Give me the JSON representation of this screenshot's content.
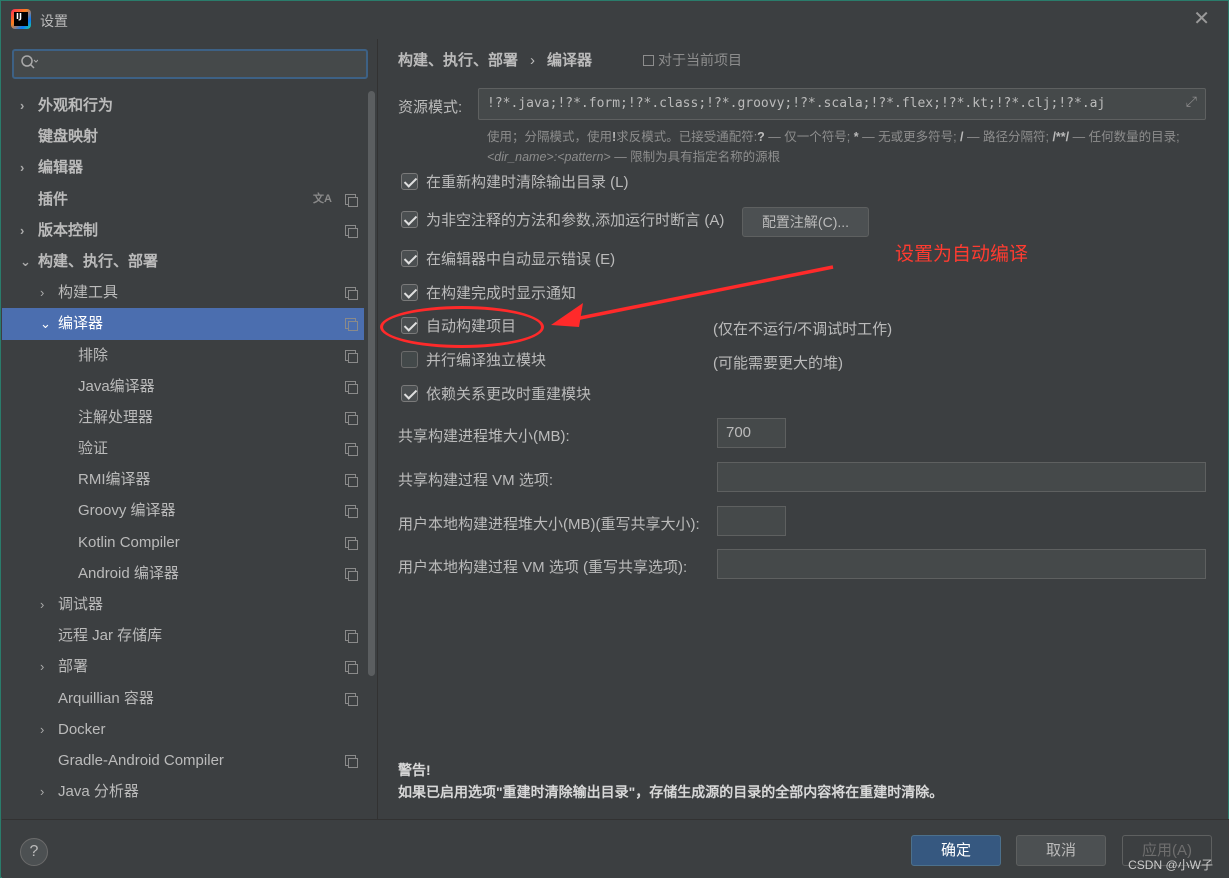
{
  "window": {
    "title": "设置",
    "close_glyph": "✕",
    "icon_text": "IJ"
  },
  "sidebar": {
    "search_placeholder": "",
    "items": [
      {
        "label": "外观和行为",
        "level": 0,
        "arrow": "›",
        "bold": true
      },
      {
        "label": "键盘映射",
        "level": 0,
        "arrow": "",
        "bold": true
      },
      {
        "label": "编辑器",
        "level": 0,
        "arrow": "›",
        "bold": true
      },
      {
        "label": "插件",
        "level": 0,
        "arrow": "",
        "bold": true,
        "icons": [
          "translate-icon",
          "project-icon"
        ]
      },
      {
        "label": "版本控制",
        "level": 0,
        "arrow": "›",
        "bold": true,
        "icons": [
          "project-icon"
        ]
      },
      {
        "label": "构建、执行、部署",
        "level": 0,
        "arrow": "⌄",
        "bold": true
      },
      {
        "label": "构建工具",
        "level": 1,
        "arrow": "›",
        "icons": [
          "project-icon"
        ]
      },
      {
        "label": "编译器",
        "level": 1,
        "arrow": "⌄",
        "selected": true,
        "icons": [
          "project-icon"
        ]
      },
      {
        "label": "排除",
        "level": 2,
        "arrow": "",
        "icons": [
          "project-icon"
        ]
      },
      {
        "label": "Java编译器",
        "level": 2,
        "arrow": "",
        "icons": [
          "project-icon"
        ]
      },
      {
        "label": "注解处理器",
        "level": 2,
        "arrow": "",
        "icons": [
          "project-icon"
        ]
      },
      {
        "label": "验证",
        "level": 2,
        "arrow": "",
        "icons": [
          "project-icon"
        ]
      },
      {
        "label": "RMI编译器",
        "level": 2,
        "arrow": "",
        "icons": [
          "project-icon"
        ]
      },
      {
        "label": "Groovy 编译器",
        "level": 2,
        "arrow": "",
        "icons": [
          "project-icon"
        ]
      },
      {
        "label": "Kotlin Compiler",
        "level": 2,
        "arrow": "",
        "icons": [
          "project-icon"
        ]
      },
      {
        "label": "Android 编译器",
        "level": 2,
        "arrow": "",
        "icons": [
          "project-icon"
        ]
      },
      {
        "label": "调试器",
        "level": 1,
        "arrow": "›"
      },
      {
        "label": "远程 Jar 存储库",
        "level": 1,
        "arrow": "",
        "icons": [
          "project-icon"
        ]
      },
      {
        "label": "部署",
        "level": 1,
        "arrow": "›",
        "icons": [
          "project-icon"
        ]
      },
      {
        "label": "Arquillian 容器",
        "level": 1,
        "arrow": "",
        "icons": [
          "project-icon"
        ]
      },
      {
        "label": "Docker",
        "level": 1,
        "arrow": "›"
      },
      {
        "label": "Gradle-Android Compiler",
        "level": 1,
        "arrow": "",
        "icons": [
          "project-icon"
        ]
      },
      {
        "label": "Java 分析器",
        "level": 1,
        "arrow": "›"
      }
    ]
  },
  "main": {
    "breadcrumb": {
      "parent": "构建、执行、部署",
      "separator": "›",
      "current": "编译器"
    },
    "for_project": "对于当前项目",
    "resource_patterns": {
      "label": "资源模式:",
      "value": "!?*.java;!?*.form;!?*.class;!?*.groovy;!?*.scala;!?*.flex;!?*.kt;!?*.clj;!?*.aj",
      "expand_glyph": "⤢"
    },
    "hint": {
      "p1": "使用；分隔模式，使用",
      "s1": "!",
      "p2": "求反模式。已接受通配符:",
      "s2": "?",
      "p3": "— 仅一个符号;",
      "s3": "*",
      "p4": "— 无或更多符号;",
      "s4": "/",
      "p5": "— 路径分隔符;",
      "s5": "/**/",
      "p6": "— 任何数量的目录;",
      "i1": "<dir_name>",
      "colon": ":",
      "i2": "<pattern>",
      "p7": "— 限制为具有指定名称的源根"
    },
    "checkboxes": [
      {
        "label": "在重新构建时清除输出目录 (L)",
        "checked": true
      },
      {
        "label": "为非空注释的方法和参数,添加运行时断言 (A)",
        "checked": true
      },
      {
        "label": "在编辑器中自动显示错误 (E)",
        "checked": true
      },
      {
        "label": "在构建完成时显示通知",
        "checked": true
      },
      {
        "label": "自动构建项目",
        "checked": true
      },
      {
        "label": "并行编译独立模块",
        "checked": false
      },
      {
        "label": "依赖关系更改时重建模块",
        "checked": true
      }
    ],
    "notes": {
      "auto_build": "(仅在不运行/不调试时工作)",
      "parallel": "(可能需要更大的堆)"
    },
    "configure_button": "配置注解(C)...",
    "fields": [
      {
        "label": "共享构建进程堆大小(MB):",
        "value": "700"
      },
      {
        "label": "共享构建过程 VM 选项:",
        "value": ""
      },
      {
        "label": "用户本地构建进程堆大小(MB)(重写共享大小):",
        "value": ""
      },
      {
        "label": "用户本地构建过程 VM 选项 (重写共享选项):",
        "value": ""
      }
    ],
    "warning": {
      "title": "警告!",
      "text": "如果已启用选项\"重建时清除输出目录\"，存储生成源的目录的全部内容将在重建时清除。"
    }
  },
  "annotation": {
    "text": "设置为自动编译",
    "color": "#ff3b30"
  },
  "footer": {
    "help": "?",
    "ok": "确定",
    "cancel": "取消",
    "apply": "应用(A)",
    "watermark": "CSDN @小W子"
  },
  "colors": {
    "background": "#3c3f41",
    "selection": "#4b6eaf",
    "ok_button": "#365880",
    "annotation": "#ff2a2a"
  }
}
